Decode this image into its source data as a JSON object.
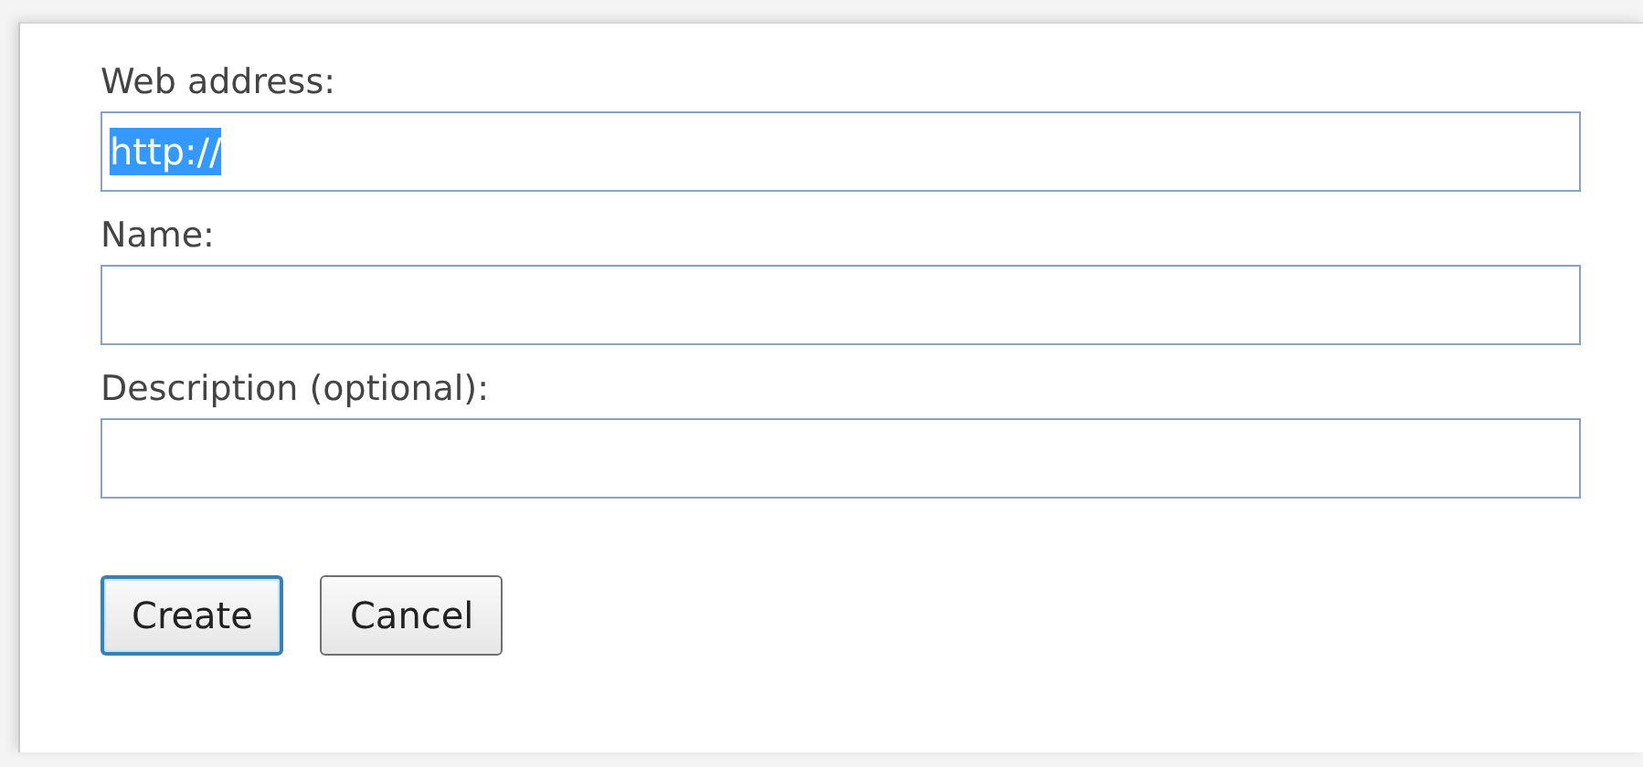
{
  "fields": [
    {
      "label": "Web address:",
      "value": "http://",
      "text_selected": true
    },
    {
      "label": "Name:"
    },
    {
      "label": "Description (optional):"
    }
  ],
  "buttons": [
    {
      "label": "Create",
      "default": true
    },
    {
      "label": "Cancel",
      "default": false
    }
  ]
}
